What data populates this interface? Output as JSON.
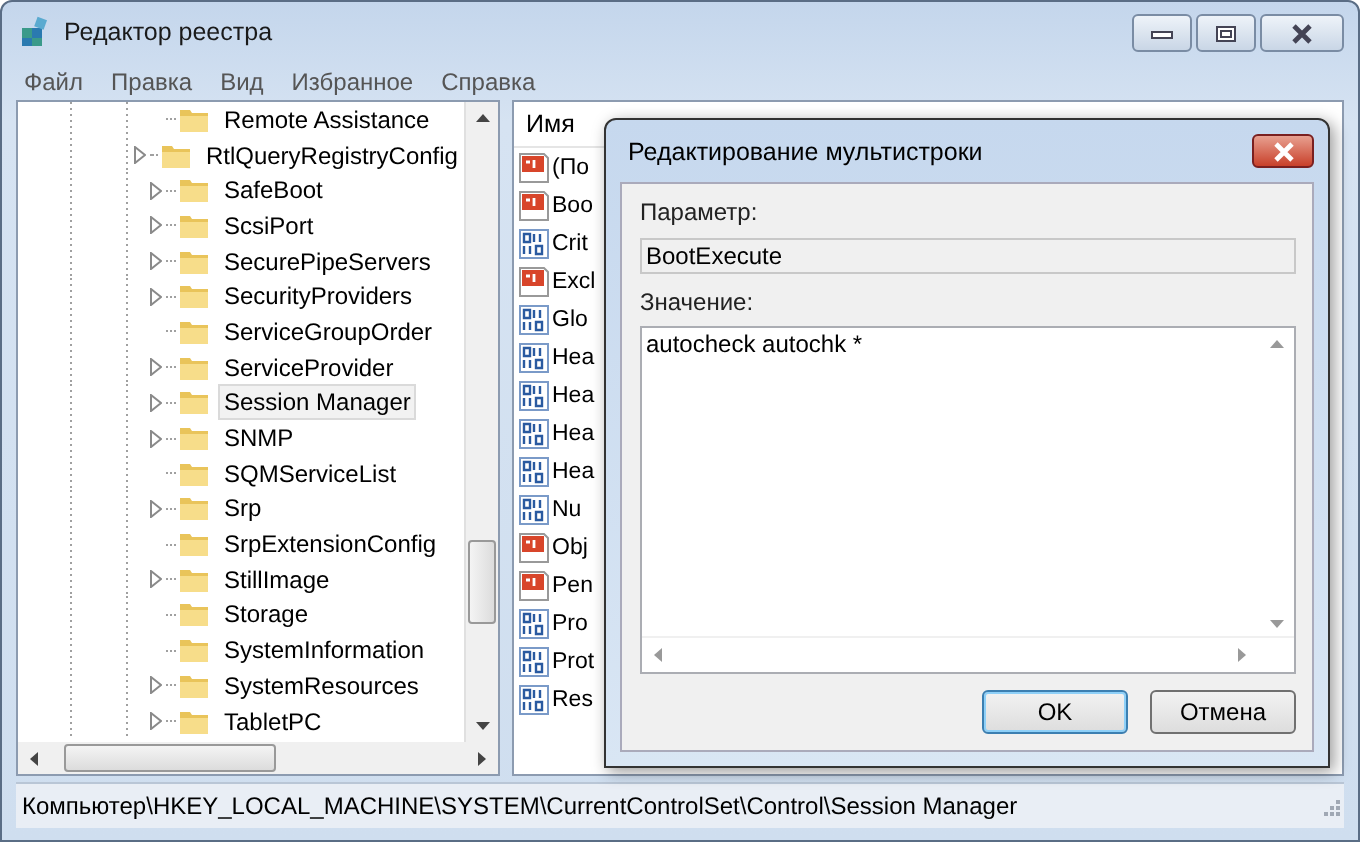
{
  "window": {
    "title": "Редактор реестра"
  },
  "menu": [
    "Файл",
    "Правка",
    "Вид",
    "Избранное",
    "Справка"
  ],
  "tree": [
    {
      "label": "Remote Assistance",
      "has_children": false,
      "selected": false
    },
    {
      "label": "RtlQueryRegistryConfig",
      "has_children": true,
      "selected": false
    },
    {
      "label": "SafeBoot",
      "has_children": true,
      "selected": false
    },
    {
      "label": "ScsiPort",
      "has_children": true,
      "selected": false
    },
    {
      "label": "SecurePipeServers",
      "has_children": true,
      "selected": false
    },
    {
      "label": "SecurityProviders",
      "has_children": true,
      "selected": false
    },
    {
      "label": "ServiceGroupOrder",
      "has_children": false,
      "selected": false
    },
    {
      "label": "ServiceProvider",
      "has_children": true,
      "selected": false
    },
    {
      "label": "Session Manager",
      "has_children": true,
      "selected": true
    },
    {
      "label": "SNMP",
      "has_children": true,
      "selected": false
    },
    {
      "label": "SQMServiceList",
      "has_children": false,
      "selected": false
    },
    {
      "label": "Srp",
      "has_children": true,
      "selected": false
    },
    {
      "label": "SrpExtensionConfig",
      "has_children": false,
      "selected": false
    },
    {
      "label": "StillImage",
      "has_children": true,
      "selected": false
    },
    {
      "label": "Storage",
      "has_children": false,
      "selected": false
    },
    {
      "label": "SystemInformation",
      "has_children": false,
      "selected": false
    },
    {
      "label": "SystemResources",
      "has_children": true,
      "selected": false
    },
    {
      "label": "TabletPC",
      "has_children": true,
      "selected": false
    }
  ],
  "values_table": {
    "columns": [
      "Имя"
    ],
    "rows": [
      {
        "name": "(По",
        "kind": "string"
      },
      {
        "name": "Boo",
        "kind": "string"
      },
      {
        "name": "Crit",
        "kind": "binary"
      },
      {
        "name": "Excl",
        "kind": "string"
      },
      {
        "name": "Glo",
        "kind": "binary"
      },
      {
        "name": "Hea",
        "kind": "binary"
      },
      {
        "name": "Hea",
        "kind": "binary"
      },
      {
        "name": "Hea",
        "kind": "binary"
      },
      {
        "name": "Hea",
        "kind": "binary"
      },
      {
        "name": "Nu",
        "kind": "binary"
      },
      {
        "name": "Obj",
        "kind": "string"
      },
      {
        "name": "Pen",
        "kind": "string"
      },
      {
        "name": "Pro",
        "kind": "binary"
      },
      {
        "name": "Prot",
        "kind": "binary"
      },
      {
        "name": "Res",
        "kind": "binary"
      }
    ]
  },
  "dialog": {
    "title": "Редактирование мультистроки",
    "parameter_label": "Параметр:",
    "parameter_value": "BootExecute",
    "value_label": "Значение:",
    "value_text": "autocheck autochk *",
    "buttons": [
      {
        "label": "OK",
        "default": true
      },
      {
        "label": "Отмена",
        "default": false
      }
    ]
  },
  "status_bar": "Компьютер\\HKEY_LOCAL_MACHINE\\SYSTEM\\CurrentControlSet\\Control\\Session Manager"
}
